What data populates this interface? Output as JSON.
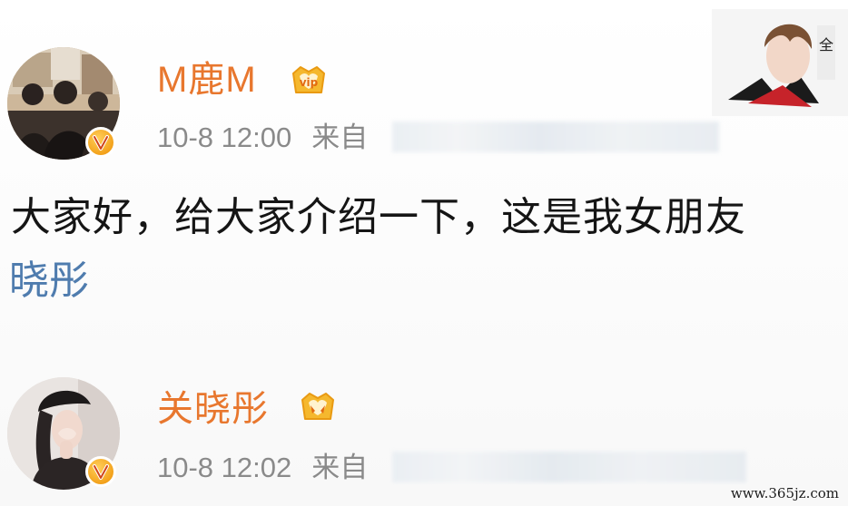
{
  "post1": {
    "username": "M鹿M",
    "time": "10-8 12:00",
    "source_prefix": "来自",
    "text": "大家好，给大家介绍一下，这是我女朋友",
    "mention": "晓彤"
  },
  "post2": {
    "username": "关晓彤",
    "time": "10-8 12:02",
    "source_prefix": "来自"
  },
  "watermark": "www.365jz.com",
  "colors": {
    "username": "#e8772e",
    "meta": "#8a8a8a",
    "mention": "#4f7cae",
    "badge": "#f3a21c"
  },
  "icons": {
    "verified": "verified-v-badge-icon",
    "vip": "vip-crown-icon"
  }
}
